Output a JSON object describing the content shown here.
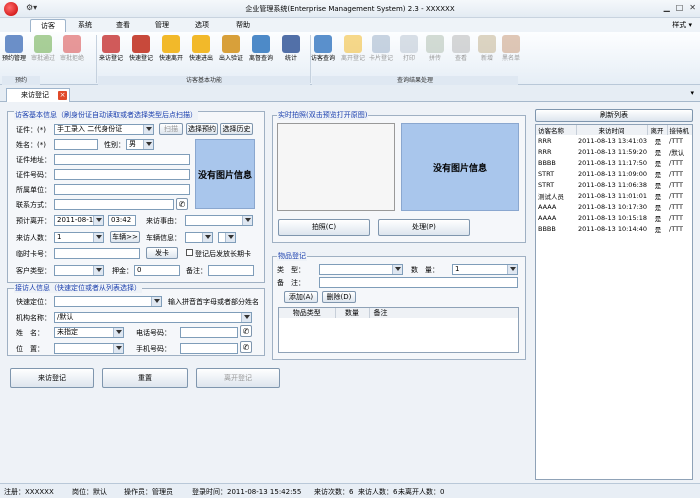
{
  "window": {
    "title": "企业管理系统(Enterprise Management System) 2.3 - XXXXXX",
    "quick_access": "⚙▾"
  },
  "menu": {
    "tabs": [
      "访客(F)",
      "系统(S)",
      "查看(V)",
      "管理(C)",
      "选项(O)",
      "帮助(H)"
    ],
    "active_index": 0,
    "style_label": "样式 ▾"
  },
  "ribbon": {
    "buttons": [
      {
        "label": "预约管理",
        "color": "#6b8fc8"
      },
      {
        "label": "审批通过",
        "color": "#66aa44",
        "disabled": true
      },
      {
        "label": "审批拒绝",
        "color": "#d94545",
        "disabled": true
      },
      {
        "label": "来访登记",
        "color": "#d05a5a"
      },
      {
        "label": "快速登记",
        "color": "#c8493b"
      },
      {
        "label": "快速离开",
        "color": "#f2b92a"
      },
      {
        "label": "快速进出",
        "color": "#f2b92a"
      },
      {
        "label": "出入验证",
        "color": "#d8a03a"
      },
      {
        "label": "离督查询",
        "color": "#4d8ac8"
      },
      {
        "label": "统计",
        "color": "#5270a8"
      },
      {
        "label": "访客查询",
        "color": "#5a90cc"
      },
      {
        "label": "离开登记",
        "color": "#f2b92a",
        "disabled": true
      },
      {
        "label": "卡片登记",
        "color": "#9db0c8",
        "disabled": true
      },
      {
        "label": "打印",
        "color": "#b9c4d1",
        "disabled": true
      },
      {
        "label": "拼传",
        "color": "#b0c0b0",
        "disabled": true
      },
      {
        "label": "查看",
        "color": "#b7b7b7",
        "disabled": true
      },
      {
        "label": "新增",
        "color": "#c2b290",
        "disabled": true
      },
      {
        "label": "黑名单",
        "color": "#c89a7a",
        "disabled": true
      }
    ],
    "groups": [
      "预约",
      "访客基本功能",
      "查询结果处理"
    ]
  },
  "doc_tab": {
    "label": "来访登记",
    "close": "×"
  },
  "visitor_form": {
    "title": "访客基本信息（刷身份证自动读取或者选择类型后点扫描）",
    "id_type_label": "证件：(*)",
    "id_type_value": "手工录入 二代身份证",
    "scan": "扫描",
    "choose_booking": "选择预约",
    "choose_history": "选择历史",
    "name_label": "姓名：(*)",
    "gender_label": "性别：",
    "gender_value": "男",
    "address_label": "证件地址：",
    "id_no_label": "证件号码：",
    "unit_label": "所属单位：",
    "contact_label": "联系方式：",
    "photo_text": "没有图片信息",
    "leave_label": "预计离开：",
    "leave_date": "2011-08-14",
    "leave_time": "03:42",
    "reason_label": "来访事由：",
    "count_label": "来访人数：",
    "count_value": "1",
    "vehicle_btn": "车辆>>",
    "vehicle_label": "车辆信息：",
    "card_label": "临时卡号：",
    "issue_btn": "发卡",
    "long_term_label": "登记后发放长期卡",
    "cust_type_label": "客户类型：",
    "deposit_label": "押金：",
    "deposit_value": "0",
    "remark_label": "备注："
  },
  "host_form": {
    "title": "接访人信息（快速定位或者从列表选择）",
    "locate_label": "快速定位：",
    "locate_hint": "输入拼音首字母或者部分姓名",
    "org_label": "机构名称：",
    "org_value": "/默认",
    "name_label": "姓　名：",
    "name_value": "未指定",
    "tel_label": "电话号码：",
    "pos_label": "位　置：",
    "mobile_label": "手机号码："
  },
  "bottom_buttons": {
    "register": "来访登记",
    "reset": "重置",
    "leave": "离开登记"
  },
  "capture": {
    "title": "实时拍照(双击预览打开原图)",
    "photo_text": "没有图片信息",
    "shoot": "拍照(C)",
    "process": "处理(P)"
  },
  "items": {
    "title": "物品登记",
    "type_label": "类　型：",
    "qty_label": "数　量：",
    "qty_value": "1",
    "remark_label": "备　注：",
    "add": "添加(A)",
    "delete": "删除(D)",
    "columns": [
      "物品类型",
      "数量",
      "备注"
    ]
  },
  "visitor_list": {
    "refresh": "刷新列表",
    "columns": [
      "访客名称",
      "来访时间",
      "离开",
      "接待机"
    ],
    "rows": [
      [
        "RRR",
        "2011-08-13 13:41:03",
        "是",
        "/TTT"
      ],
      [
        "RRR",
        "2011-08-13 11:59:20",
        "是",
        "/默认"
      ],
      [
        "BBBB",
        "2011-08-13 11:17:50",
        "是",
        "/TTT"
      ],
      [
        "STRT",
        "2011-08-13 11:09:00",
        "是",
        "/TTT"
      ],
      [
        "STRT",
        "2011-08-13 11:06:38",
        "是",
        "/TTT"
      ],
      [
        "测试人员",
        "2011-08-13 11:01:01",
        "是",
        "/TTT"
      ],
      [
        "AAAA",
        "2011-08-13 10:17:30",
        "是",
        "/TTT"
      ],
      [
        "AAAA",
        "2011-08-13 10:15:18",
        "是",
        "/TTT"
      ],
      [
        "BBBB",
        "2011-08-13 10:14:40",
        "是",
        "/TTT"
      ]
    ]
  },
  "status": {
    "reg": "注册：XXXXXX",
    "post": "岗位：默认",
    "operator": "操作员：管理员",
    "login": "登录时间：2011-08-13 15:42:55",
    "count": "来访次数：6",
    "visitors": "来访人数：6",
    "not_left": "未离开人数：0"
  }
}
